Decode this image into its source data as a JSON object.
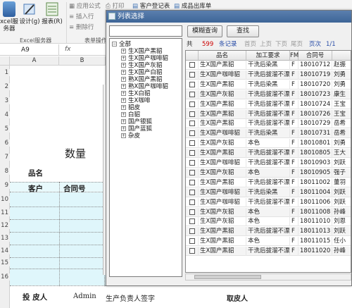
{
  "ribbon": {
    "excel_server_label": "xcel服\n务器",
    "design_label": "设计(g)",
    "report_label": "报表(R)",
    "group_excel_server": "Excel服务器",
    "group_form_ops": "表单操作",
    "apply_formula": "应用公式",
    "print": "打印",
    "insert_row": "插入行",
    "delete_row": "删除行",
    "customer_register": "客户登记表",
    "product_outbound": "成品出库单"
  },
  "formula_bar": {
    "cell_ref": "A9",
    "fx": "fx"
  },
  "sheet": {
    "col_a": "A",
    "col_b": "B",
    "row_numbers": [
      "1",
      "2",
      "3",
      "4",
      "5",
      "6",
      "7",
      "8",
      "9",
      "10",
      "11",
      "12",
      "13",
      "14",
      "15",
      "16"
    ],
    "quantity_label": "数量",
    "product_name_label": "品名",
    "customer_label": "客户",
    "contract_no_label": "合同号",
    "bottom_investor_label": "投 皮人",
    "bottom_user": "Admin",
    "bottom_signature": "生产负责人签字",
    "bottom_receiver": "取皮人"
  },
  "dialog": {
    "title": "列表选择",
    "search_placeholder": "",
    "fuzzy_query_button": "模糊查询",
    "query_button": "查找",
    "pager": {
      "total_prefix": "共",
      "total_count": "599",
      "records_suffix": "条记录",
      "first_page": "首页",
      "prev_page": "上页",
      "next_page": "下页",
      "last_page": "尾页",
      "page_label": "页次",
      "page_value": "1/1"
    },
    "tree": {
      "root": "全部",
      "children": [
        "生X国产黑貂",
        "生X国产咖啡貂",
        "生X国产灰貂",
        "生X国产白貂",
        "熟X国产黑貂",
        "熟X国产咖啡貂",
        "生X白貂",
        "生X咖啡",
        "貂皮",
        "白貂",
        "国产银狐",
        "国产蓝狐",
        "杂皮"
      ]
    },
    "grid": {
      "headers": [
        "",
        "品名",
        "加工要求",
        "FM",
        "合同号",
        ""
      ],
      "rows": [
        {
          "name": "生X国产黑貂",
          "req": "干洗后染黑",
          "fm": "F",
          "contract": "18010712",
          "extra": "赵振"
        },
        {
          "name": "生X国产咖啡貂",
          "req": "干洗后拔溜不漂",
          "fm": "F",
          "contract": "18010719",
          "extra": "刘勇"
        },
        {
          "name": "生X国产黑貂",
          "req": "干洗后染黑",
          "fm": "F",
          "contract": "18010720",
          "extra": "刘勇"
        },
        {
          "name": "生X国产灰貂",
          "req": "干洗后拔溜不漂",
          "fm": "F",
          "contract": "18010723",
          "extra": "康生"
        },
        {
          "name": "生X国产黑貂",
          "req": "干洗后拔溜不漂",
          "fm": "F",
          "contract": "18010724",
          "extra": "王宝"
        },
        {
          "name": "生X国产黑貂",
          "req": "干洗后拔溜不漂",
          "fm": "F",
          "contract": "18010726",
          "extra": "王宝"
        },
        {
          "name": "生X国产黑貂",
          "req": "干洗后拔溜不漂",
          "fm": "F",
          "contract": "18010729",
          "extra": "岳希"
        },
        {
          "name": "生X国产咖啡貂",
          "req": "干洗后染黑",
          "fm": "F",
          "contract": "18010731",
          "extra": "岳希"
        },
        {
          "name": "生X国产灰貂",
          "req": "本色",
          "fm": "F",
          "contract": "18010801",
          "extra": "刘勇"
        },
        {
          "name": "生X国产黑貂",
          "req": "干洗后拔溜不漂",
          "fm": "F",
          "contract": "18010805",
          "extra": "王大"
        },
        {
          "name": "生X国产咖啡貂",
          "req": "干洗后拔溜不漂",
          "fm": "F",
          "contract": "18010903",
          "extra": "刘跃"
        },
        {
          "name": "生X国产灰貂",
          "req": "本色",
          "fm": "F",
          "contract": "18010905",
          "extra": "强子"
        },
        {
          "name": "生X国产黑貂",
          "req": "干洗后拔溜不漂",
          "fm": "F",
          "contract": "18011002",
          "extra": "董羽"
        },
        {
          "name": "生X国产咖啡貂",
          "req": "干洗后染黑",
          "fm": "F",
          "contract": "18011004",
          "extra": "刘跃"
        },
        {
          "name": "生X国产咖啡貂",
          "req": "干洗后拔溜不漂",
          "fm": "F",
          "contract": "18011006",
          "extra": "刘跃"
        },
        {
          "name": "生X国产灰貂",
          "req": "本色",
          "fm": "F",
          "contract": "18011008",
          "extra": "孙峰"
        },
        {
          "name": "生X国产灰貂",
          "req": "本色",
          "fm": "F",
          "contract": "18011010",
          "extra": "刘恩"
        },
        {
          "name": "生X国产黑貂",
          "req": "干洗后拔溜不漂",
          "fm": "F",
          "contract": "18011013",
          "extra": "刘跃"
        },
        {
          "name": "生X国产黑貂",
          "req": "本色",
          "fm": "F",
          "contract": "18011015",
          "extra": "任小"
        },
        {
          "name": "生X国产黑貂",
          "req": "干洗后拔溜不漂",
          "fm": "F",
          "contract": "18011020",
          "extra": "孙峰"
        }
      ]
    }
  },
  "colors": {
    "cyan_cell": "#dff6fb",
    "title_bar": "#4a71a3",
    "pager_red": "#cc0000",
    "pager_link": "#2b4fa8"
  }
}
